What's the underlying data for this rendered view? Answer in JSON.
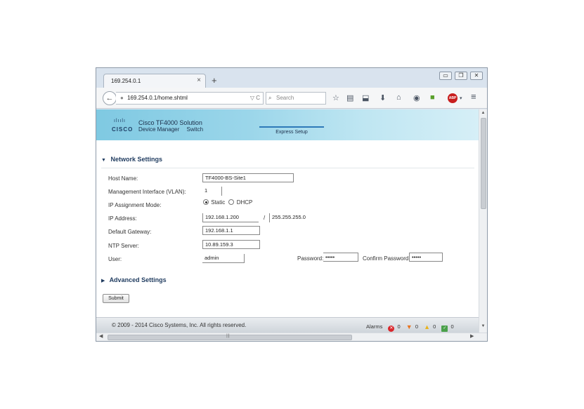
{
  "browser": {
    "tab_title": "169.254.0.1",
    "tab_close": "×",
    "new_tab": "+",
    "url": "169.254.0.1/home.shtml",
    "url_tools": "▽ C",
    "search_placeholder": "Search",
    "window_controls": [
      "▭",
      "❐",
      "✕"
    ],
    "toolbar_icons": [
      "star-icon",
      "reading-list-icon",
      "pocket-icon",
      "download-icon",
      "home-icon",
      "chat-icon",
      "extension-icon",
      "adblock-icon",
      "menu-icon"
    ],
    "adblock_label": "ABP"
  },
  "banner": {
    "logo_bars": "ılıılı",
    "logo_text": "CISCO",
    "product_title": "Cisco TF4000 Solution",
    "nav_links": [
      "Device Manager",
      "Switch"
    ],
    "active_tab": "Express Setup"
  },
  "network_settings": {
    "title": "Network Settings",
    "host_name": {
      "label": "Host Name:",
      "value": "TF4000-BS-Site1"
    },
    "mgmt_vlan": {
      "label": "Management Interface (VLAN):",
      "value": "1"
    },
    "ip_mode": {
      "label": "IP Assignment Mode:",
      "options": [
        "Static",
        "DHCP"
      ],
      "selected": "Static"
    },
    "ip_address": {
      "label": "IP Address:",
      "value": "192.168.1.200",
      "separator": "/",
      "mask": "255.255.255.0"
    },
    "gateway": {
      "label": "Default Gateway:",
      "value": "192.168.1.1"
    },
    "ntp": {
      "label": "NTP Server:",
      "value": "10.89.159.3"
    },
    "user": {
      "label": "User:",
      "value": "admin"
    },
    "password": {
      "label": "Password:",
      "value": "•••••"
    },
    "confirm_password": {
      "label": "Confirm Password:",
      "value": "•••••"
    }
  },
  "advanced_settings": {
    "title": "Advanced Settings"
  },
  "submit_label": "Submit",
  "footer": {
    "copyright": "© 2009 - 2014 Cisco Systems, Inc. All rights reserved.",
    "alarms_label": "Alarms",
    "counts": {
      "critical": "0",
      "major": "0",
      "minor": "0",
      "ok": "0"
    },
    "colors": {
      "critical": "#d9262b",
      "major": "#e8731d",
      "minor": "#e9b31a",
      "ok": "#4aa04a"
    }
  },
  "scroll": {
    "h_grip": "|||"
  }
}
